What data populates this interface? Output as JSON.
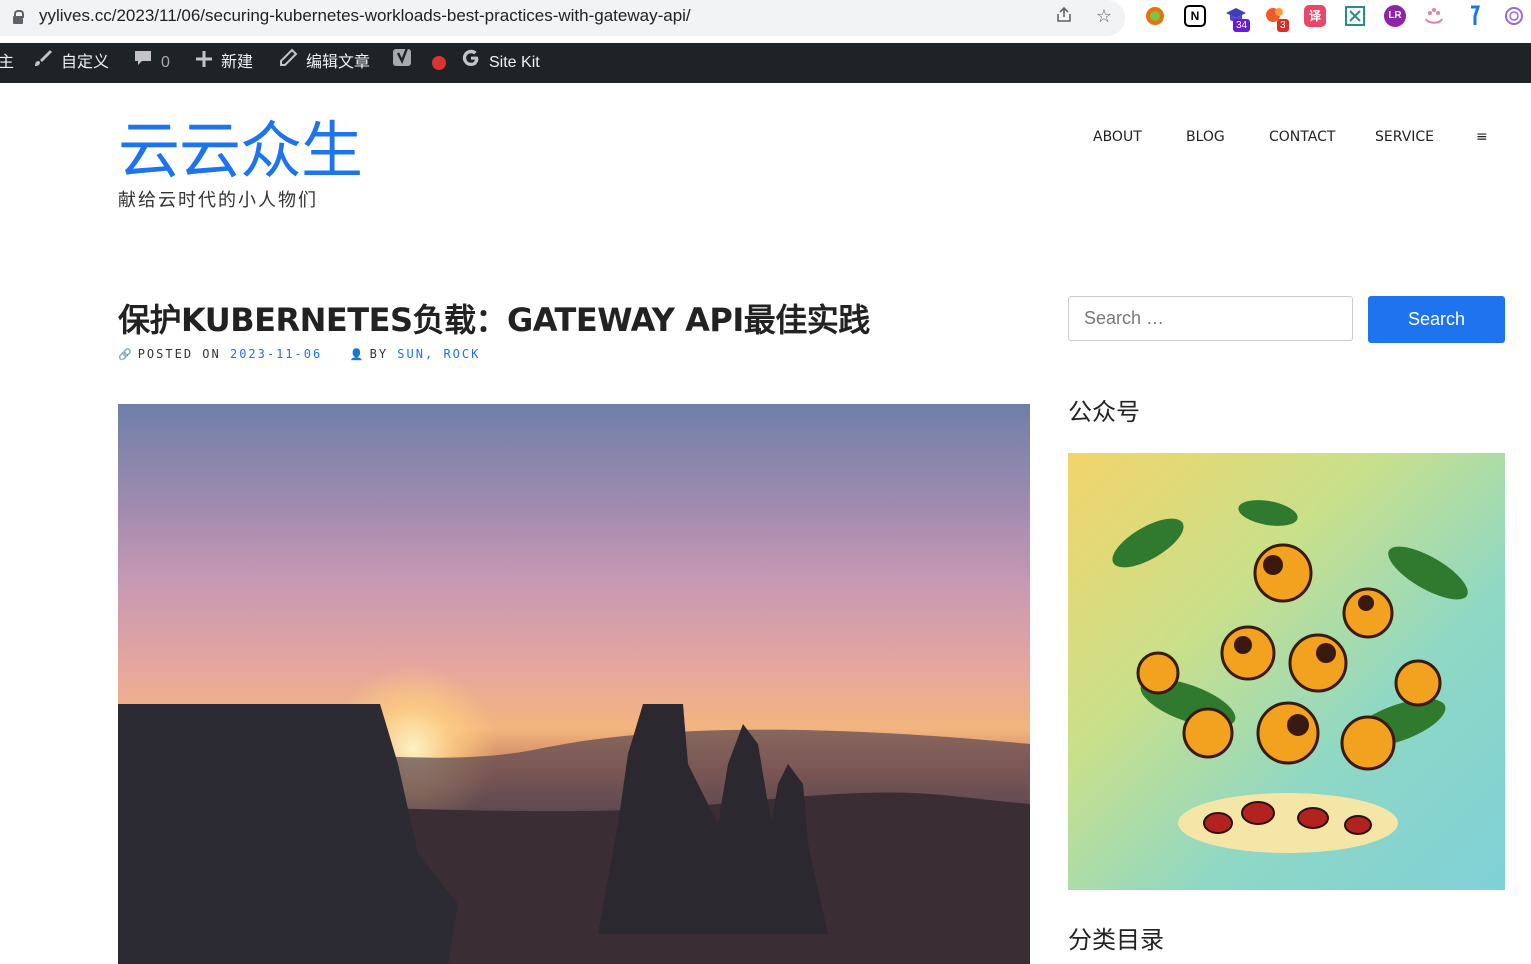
{
  "browser": {
    "url": "yylives.cc/2023/11/06/securing-kubernetes-workloads-best-practices-with-gateway-api/",
    "extensions": [
      {
        "icon": "circle-ext-icon",
        "color": "#e8710a"
      },
      {
        "icon": "notion-icon",
        "label": "N",
        "color": "#000000"
      },
      {
        "icon": "mortarboard-ext-icon",
        "badge": "34",
        "color": "#5b3fd6"
      },
      {
        "icon": "blob-ext-icon",
        "badge": "3",
        "color": "#f05a28"
      },
      {
        "icon": "translate-ext-icon",
        "label": "译",
        "color": "#e8476a"
      },
      {
        "icon": "grid-ext-icon",
        "color": "#2a8c8c"
      },
      {
        "icon": "lr-ext-icon",
        "color": "#8e24aa"
      },
      {
        "icon": "paw-ext-icon",
        "color": "#e07fae"
      },
      {
        "icon": "pin-ext-icon",
        "color": "#1e73ee"
      },
      {
        "icon": "openai-ext-icon",
        "color": "#9c6ad6"
      }
    ]
  },
  "admin_bar": {
    "site_label": "主",
    "customize": "自定义",
    "comments_count": "0",
    "new": "新建",
    "edit_post": "编辑文章",
    "site_kit": "Site Kit"
  },
  "header": {
    "site_title": "云云众生",
    "tagline": "献给云时代的小人物们",
    "nav": [
      "ABOUT",
      "BLOG",
      "CONTACT",
      "SERVICE"
    ],
    "nav_more": "≡"
  },
  "post": {
    "title": "保护KUBERNETES负载：GATEWAY API最佳实践",
    "posted_on_label": "POSTED ON",
    "date": "2023-11-06",
    "by_label": "BY",
    "authors": "SUN",
    "separator": ",",
    "author2": "ROCK"
  },
  "sidebar": {
    "search_placeholder": "Search …",
    "search_button": "Search",
    "widget1_title": "公众号",
    "widget2_title": "分类目录"
  },
  "colors": {
    "accent": "#1e73ee",
    "admin_bar": "#1d2327"
  }
}
